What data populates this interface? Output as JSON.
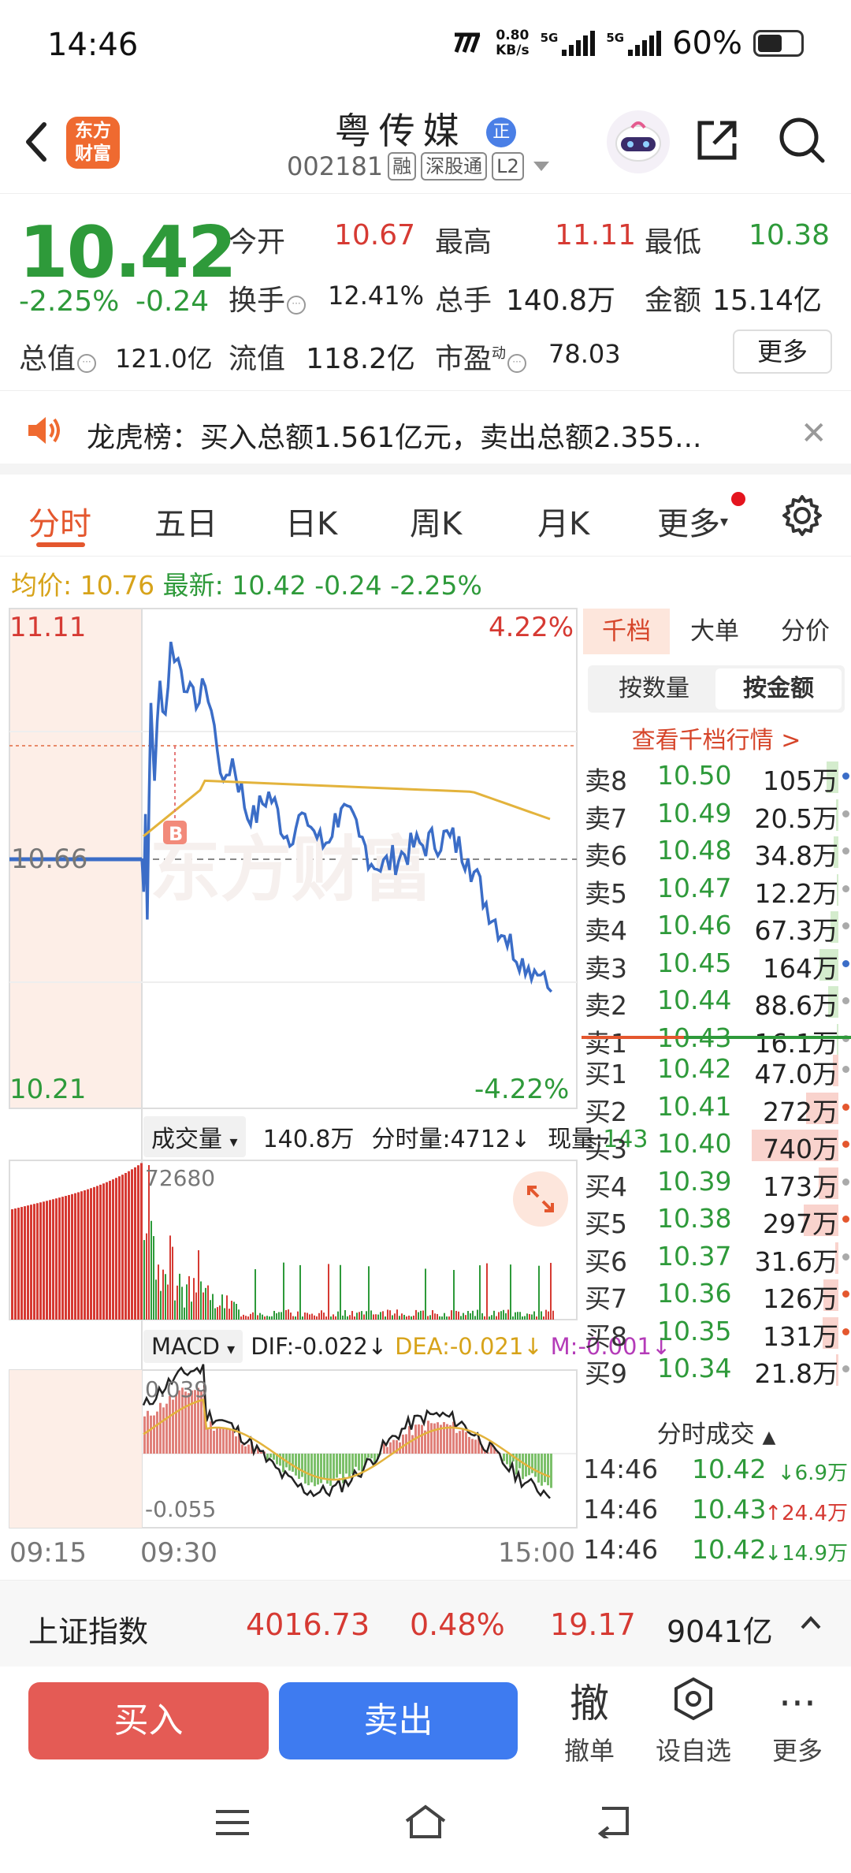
{
  "status": {
    "time": "14:46",
    "net_speed_value": "0.80",
    "net_speed_unit": "KB/s",
    "sig1": "5G",
    "sig2": "5G",
    "battery": "60%"
  },
  "header": {
    "logo_line1": "东方",
    "logo_line2": "财富",
    "stock_name": "粤传媒",
    "badge": "正",
    "code": "002181",
    "tag_rong": "融",
    "tag_sgt": "深股通",
    "tag_l2": "L2"
  },
  "quote": {
    "price": "10.42",
    "change_pct": "-2.25%",
    "change": "-0.24",
    "open_label": "今开",
    "open": "10.67",
    "high_label": "最高",
    "high": "11.11",
    "low_label": "最低",
    "low": "10.38",
    "turnover_label": "换手",
    "turnover": "12.41%",
    "volume_label": "总手",
    "volume": "140.8万",
    "amount_label": "金额",
    "amount": "15.14亿",
    "mktcap_label": "总值",
    "mktcap": "121.0亿",
    "float_label": "流值",
    "float": "118.2亿",
    "pe_label": "市盈",
    "pe_sup": "动",
    "pe": "78.03",
    "more": "更多"
  },
  "notice": {
    "text": "龙虎榜：买入总额1.561亿元，卖出总额2.355..."
  },
  "tabs": [
    "分时",
    "五日",
    "日K",
    "周K",
    "月K",
    "更多"
  ],
  "avg": {
    "avg_label": "均价:",
    "avg": "10.76",
    "last_label": "最新:",
    "last": "10.42",
    "chg": "-0.24",
    "pct": "-2.25%"
  },
  "chart": {
    "top_price": "11.11",
    "top_pct": "4.22%",
    "mid_price": "10.66",
    "bot_price": "10.21",
    "bot_pct": "-4.22%",
    "buy_marker": "B",
    "watermark": "东方财富",
    "vol_selector": "成交量",
    "vol_total": "140.8万",
    "vol_per_min": "分时量:4712",
    "vol_now_label": "现量:",
    "vol_now": "143",
    "vol_max": "72680",
    "macd_selector": "MACD",
    "dif": "DIF:-0.022",
    "dea": "DEA:-0.021",
    "m": "M:-0.001",
    "macd_top": "0.039",
    "macd_bot": "-0.055",
    "x_labels": [
      "09:15",
      "09:30",
      "15:00"
    ],
    "colors": {
      "price": "#3b6dc7",
      "avg": "#e3b33c",
      "up": "#d63a33",
      "down": "#2e9a3a"
    }
  },
  "chart_data": {
    "type": "line",
    "price_line": [
      [
        9.25,
        10.66
      ],
      [
        9.3,
        10.66
      ],
      [
        9.31,
        10.6
      ],
      [
        9.32,
        10.74
      ],
      [
        9.33,
        10.55
      ],
      [
        9.35,
        10.94
      ],
      [
        9.37,
        10.8
      ],
      [
        9.4,
        10.98
      ],
      [
        9.43,
        10.92
      ],
      [
        9.46,
        11.05
      ],
      [
        9.5,
        11.02
      ],
      [
        9.55,
        10.96
      ],
      [
        10.0,
        10.93
      ],
      [
        10.05,
        10.97
      ],
      [
        10.1,
        10.9
      ],
      [
        10.15,
        10.8
      ],
      [
        10.2,
        10.84
      ],
      [
        10.3,
        10.72
      ],
      [
        10.4,
        10.78
      ],
      [
        10.5,
        10.7
      ],
      [
        11.0,
        10.74
      ],
      [
        11.1,
        10.68
      ],
      [
        11.2,
        10.75
      ],
      [
        11.3,
        10.7
      ],
      [
        13.1,
        10.64
      ],
      [
        13.3,
        10.68
      ],
      [
        13.5,
        10.7
      ],
      [
        14.0,
        10.66
      ],
      [
        14.1,
        10.58
      ],
      [
        14.2,
        10.52
      ],
      [
        14.3,
        10.48
      ],
      [
        14.4,
        10.45
      ],
      [
        14.46,
        10.42
      ]
    ],
    "avg_line_value": "10.76",
    "y_range": [
      10.21,
      11.11
    ],
    "pre_close": 10.66
  },
  "book": {
    "tabs": [
      "千档",
      "大单",
      "分价"
    ],
    "sub": [
      "按数量",
      "按金额"
    ],
    "link": "查看千档行情 >",
    "asks": [
      {
        "n": "卖8",
        "p": "10.50",
        "v": "105万",
        "w": 0.14,
        "d": "#3b6dc7"
      },
      {
        "n": "卖7",
        "p": "10.49",
        "v": "20.5万",
        "w": 0.03,
        "d": "#aaa"
      },
      {
        "n": "卖6",
        "p": "10.48",
        "v": "34.8万",
        "w": 0.05,
        "d": "#aaa"
      },
      {
        "n": "卖5",
        "p": "10.47",
        "v": "12.2万",
        "w": 0.02,
        "d": "#aaa"
      },
      {
        "n": "卖4",
        "p": "10.46",
        "v": "67.3万",
        "w": 0.09,
        "d": "#aaa"
      },
      {
        "n": "卖3",
        "p": "10.45",
        "v": "164万",
        "w": 0.22,
        "d": "#3b6dc7"
      },
      {
        "n": "卖2",
        "p": "10.44",
        "v": "88.6万",
        "w": 0.12,
        "d": "#aaa"
      },
      {
        "n": "卖1",
        "p": "10.43",
        "v": "16.1万",
        "w": 0.02,
        "d": "#aaa"
      }
    ],
    "bids": [
      {
        "n": "买1",
        "p": "10.42",
        "v": "47.0万",
        "w": 0.06,
        "d": "#aaa"
      },
      {
        "n": "买2",
        "p": "10.41",
        "v": "272万",
        "w": 0.37,
        "d": "#e4572e"
      },
      {
        "n": "买3",
        "p": "10.40",
        "v": "740万",
        "w": 1.0,
        "d": "#e4572e"
      },
      {
        "n": "买4",
        "p": "10.39",
        "v": "173万",
        "w": 0.23,
        "d": "#aaa"
      },
      {
        "n": "买5",
        "p": "10.38",
        "v": "297万",
        "w": 0.4,
        "d": "#e4572e"
      },
      {
        "n": "买6",
        "p": "10.37",
        "v": "31.6万",
        "w": 0.04,
        "d": "#aaa"
      },
      {
        "n": "买7",
        "p": "10.36",
        "v": "126万",
        "w": 0.17,
        "d": "#e4572e"
      },
      {
        "n": "买8",
        "p": "10.35",
        "v": "131万",
        "w": 0.18,
        "d": "#e4572e"
      },
      {
        "n": "买9",
        "p": "10.34",
        "v": "21.8万",
        "w": 0.03,
        "d": "#aaa"
      }
    ],
    "ticks_header": "分时成交",
    "ticks": [
      {
        "t": "14:46",
        "p": "10.42",
        "v": "↓6.9万",
        "c": "#2e9a3a"
      },
      {
        "t": "14:46",
        "p": "10.43",
        "v": "↑24.4万",
        "c": "#d63a33"
      },
      {
        "t": "14:46",
        "p": "10.42",
        "v": "↓14.9万",
        "c": "#2e9a3a"
      }
    ]
  },
  "index": {
    "name": "上证指数",
    "value": "4016.73",
    "pct": "0.48%",
    "chg": "19.17",
    "amount": "9041亿"
  },
  "actions": {
    "buy": "买入",
    "sell": "卖出",
    "cancel_icon": "撤",
    "cancel": "撤单",
    "watch": "设自选",
    "more": "更多"
  }
}
